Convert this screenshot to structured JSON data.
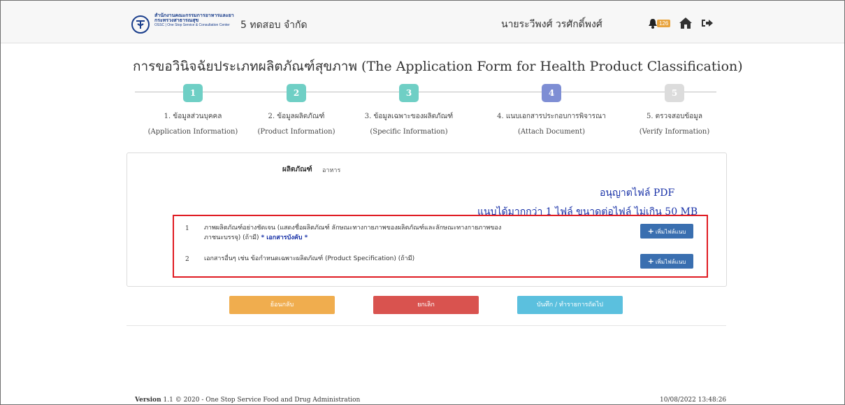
{
  "header": {
    "logo_line1": "สำนักงานคณะกรรมการอาหารและยา",
    "logo_line2": "กระทรวงสาธารณสุข",
    "logo_line3": "OSSC | One Stop Service & Consultation Center",
    "company": "5 ทดสอบ จำกัด",
    "username": "นายระวีพงศ์ วรศักดิ์พงศ์",
    "notification_count": "126",
    "icons": [
      "bell-icon",
      "home-icon",
      "logout-icon"
    ]
  },
  "title": "การขอวินิจฉัยประเภทผลิตภัณฑ์สุขภาพ (The Application Form for Health Product Classification)",
  "steps": [
    {
      "number": "1",
      "label_th": "1. ข้อมูลส่วนบุคคล",
      "label_en": "(Application Information)",
      "color": "#6fcfc5"
    },
    {
      "number": "2",
      "label_th": "2. ข้อมูลผลิตภัณฑ์",
      "label_en": "(Product Information)",
      "color": "#6fcfc5"
    },
    {
      "number": "3",
      "label_th": "3. ข้อมูลเฉพาะของผลิตภัณฑ์",
      "label_en": "(Specific Information)",
      "color": "#6fcfc5"
    },
    {
      "number": "4",
      "label_th": "4. แนบเอกสารประกอบการพิจารณา",
      "label_en": "(Attach Document)",
      "color": "#7e8ed4"
    },
    {
      "number": "5",
      "label_th": "5. ตรวจสอบข้อมูล",
      "label_en": "(Verify Information)",
      "color": "#dcdcdc"
    }
  ],
  "product": {
    "label": "ผลิตภัณฑ์",
    "value": "อาหาร"
  },
  "allow_text": "อนุญาตไฟล์ PDF",
  "more_text": "แนบได้มากกว่า 1 ไฟล์ ขนาดต่อไฟล์ ไม่เกิน 50 MB",
  "documents": [
    {
      "num": "1",
      "text_line1": "ภาพผลิตภัณฑ์อย่างชัดเจน (แสดงชื่อผลิตภัณฑ์ ลักษณะทางกายภาพของผลิตภัณฑ์และลักษณะทางกายภาพของ",
      "text_line2": "ภาชนะบรรจุ) (ถ้ามี)",
      "required": "* เอกสารบังคับ *",
      "button": "เพิ่มไฟล์แนบ"
    },
    {
      "num": "2",
      "text_line1": "เอกสารอื่นๆ เช่น ข้อกำหนดเฉพาะผลิตภัณฑ์ (Product Specification) (ถ้ามี)",
      "button": "เพิ่มไฟล์แนบ"
    }
  ],
  "buttons": {
    "back": "ย้อนกลับ",
    "cancel": "ยกเลิก",
    "save": "บันทึก / ทำรายการถัดไป",
    "back_color": "#f0ad4e",
    "cancel_color": "#d9534f",
    "save_color": "#5bc0de"
  },
  "footer": {
    "version_label": "Version",
    "version_text": "1.1 © 2020 - One Stop Service Food and Drug Administration",
    "datetime": "10/08/2022 13:48:26"
  }
}
